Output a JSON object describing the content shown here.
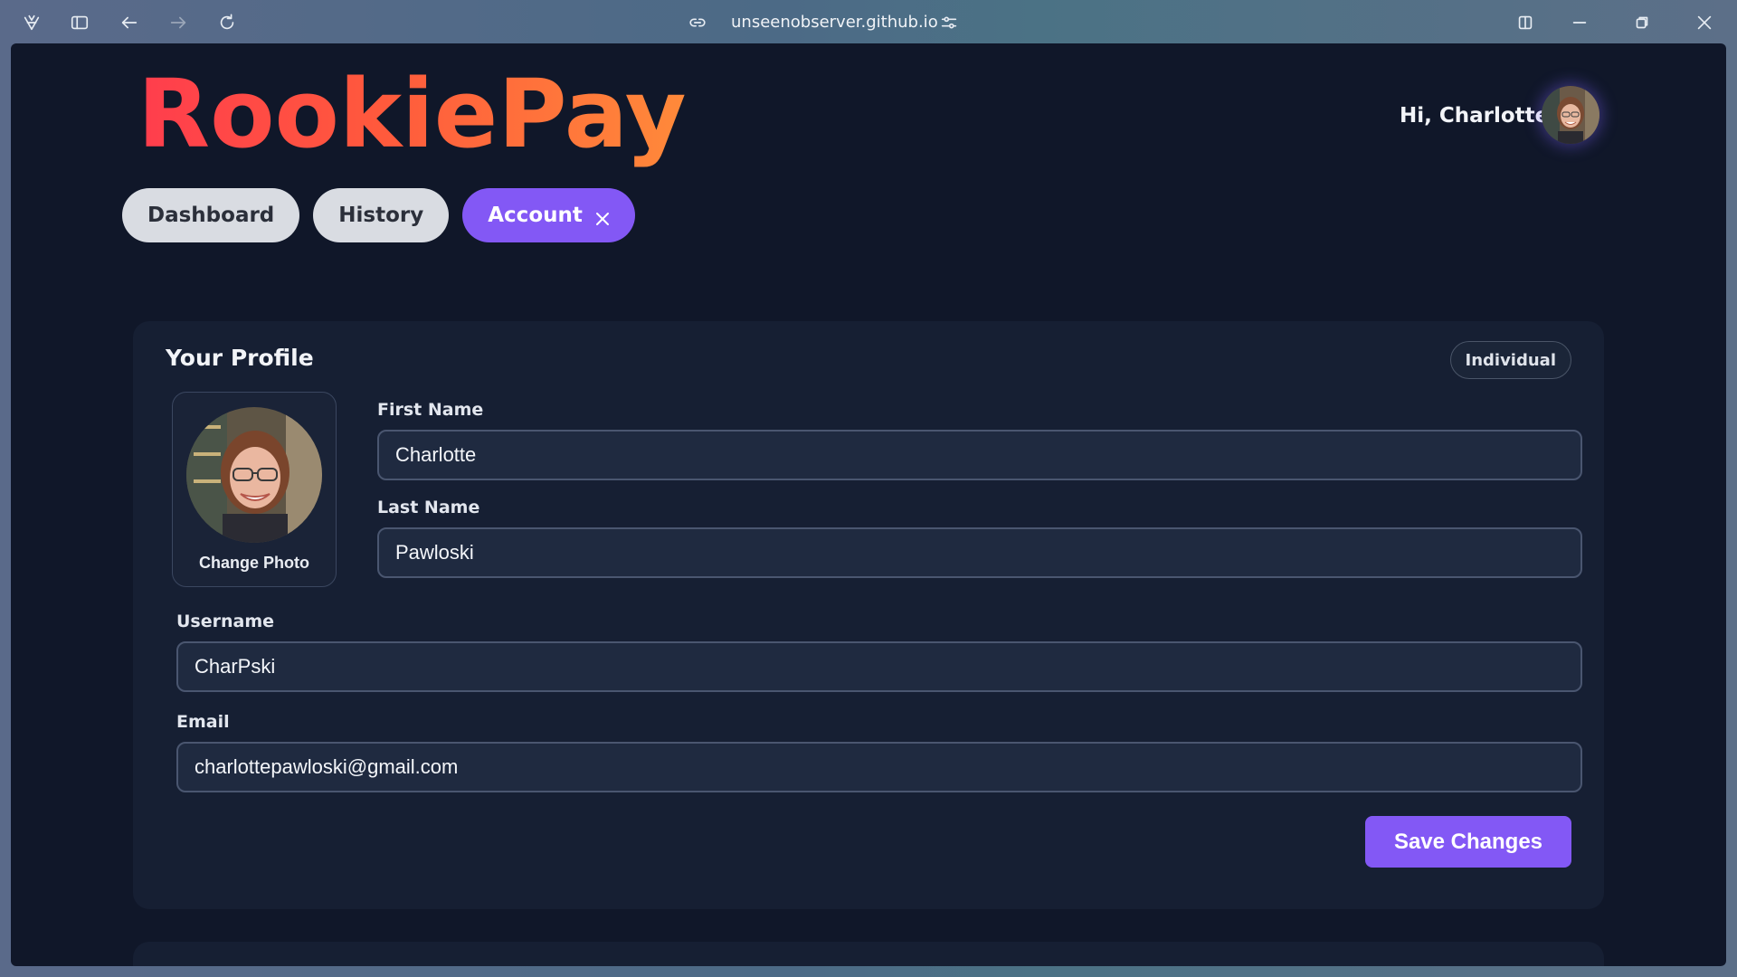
{
  "browser": {
    "url": "unseenobserver.github.io"
  },
  "app": {
    "logo_text": "RookiePay",
    "greeting": "Hi, Charlotte"
  },
  "nav": {
    "tabs": [
      {
        "label": "Dashboard"
      },
      {
        "label": "History"
      },
      {
        "label": "Account"
      }
    ]
  },
  "profile": {
    "title": "Your Profile",
    "badge": "Individual",
    "change_photo_label": "Change Photo",
    "first_name_label": "First Name",
    "first_name_value": "Charlotte",
    "last_name_label": "Last Name",
    "last_name_value": "Pawloski",
    "username_label": "Username",
    "username_value": "CharPski",
    "email_label": "Email",
    "email_value": "charlottepawloski@gmail.com",
    "save_label": "Save Changes"
  },
  "colors": {
    "accent": "#8358f5",
    "background": "#101729",
    "card": "#161f33",
    "logo_start": "#ff3d4d",
    "logo_end": "#ff8a3a"
  }
}
